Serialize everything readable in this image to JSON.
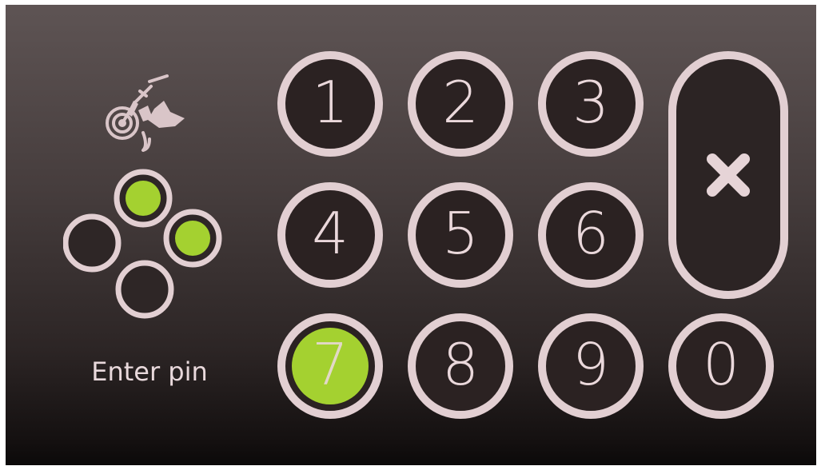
{
  "app": {
    "pin_label": "Enter pin"
  },
  "icons": {
    "logo": "wheelchair-handbike-icon",
    "delete": "close-icon"
  },
  "pin_indicator": {
    "dots": [
      {
        "position": "top",
        "filled": true
      },
      {
        "position": "left",
        "filled": false
      },
      {
        "position": "right",
        "filled": true
      },
      {
        "position": "bottom",
        "filled": false
      }
    ]
  },
  "keypad": {
    "keys": [
      "1",
      "2",
      "3",
      "4",
      "5",
      "6",
      "7",
      "8",
      "9",
      "0"
    ],
    "pressed_key": "7"
  },
  "colors": {
    "accent_green": "#a4d130",
    "ring": "#e2cfd2",
    "key_fill": "#2b2222",
    "text": "#ead8db"
  }
}
